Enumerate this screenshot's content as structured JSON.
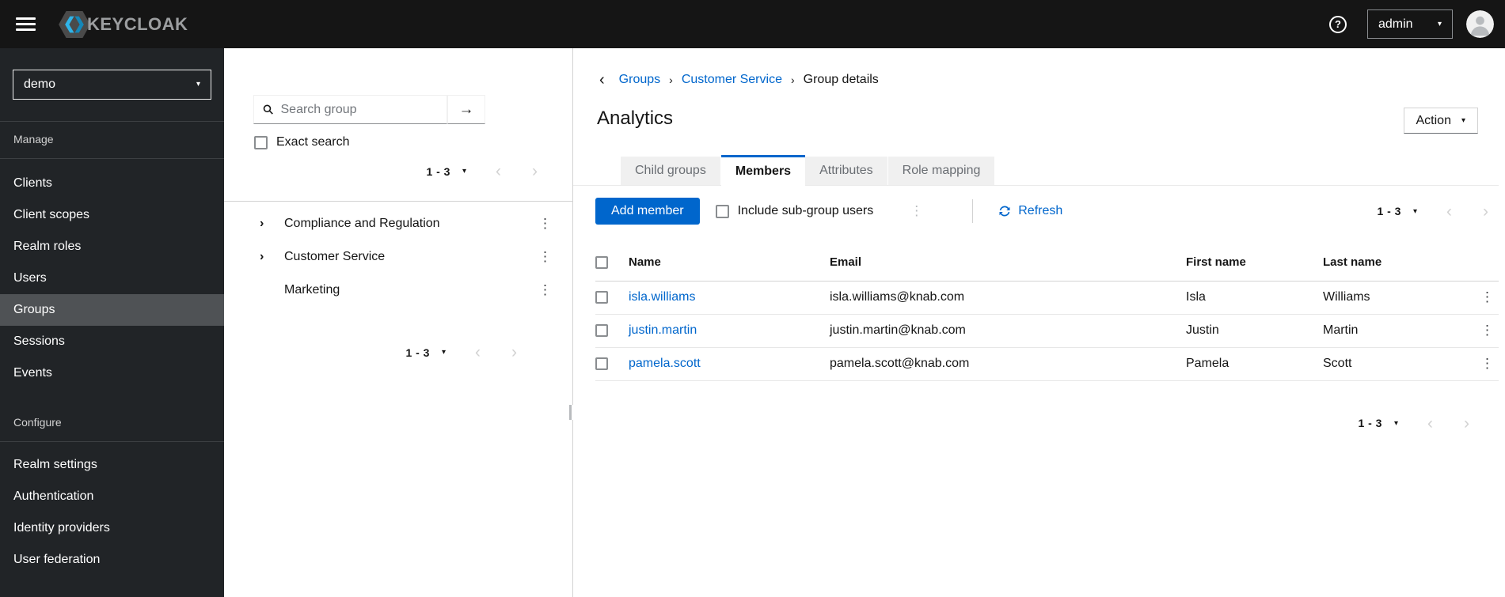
{
  "topbar": {
    "brand": "KEYCLOAK",
    "username": "admin"
  },
  "realm": {
    "name": "demo"
  },
  "sidebar": {
    "manage_label": "Manage",
    "manage_items": [
      "Clients",
      "Client scopes",
      "Realm roles",
      "Users",
      "Groups",
      "Sessions",
      "Events"
    ],
    "active_item": "Groups",
    "configure_label": "Configure",
    "configure_items": [
      "Realm settings",
      "Authentication",
      "Identity providers",
      "User federation"
    ]
  },
  "group_tree": {
    "search_placeholder": "Search group",
    "exact_search_label": "Exact search",
    "pagination_range": "1 - 3",
    "items": [
      {
        "label": "Compliance and Regulation",
        "expandable": true
      },
      {
        "label": "Customer Service",
        "expandable": true
      },
      {
        "label": "Marketing",
        "expandable": false
      }
    ]
  },
  "main": {
    "breadcrumb": {
      "groups": "Groups",
      "parent": "Customer Service",
      "current": "Group details"
    },
    "title": "Analytics",
    "action_button_label": "Action",
    "tabs": [
      {
        "label": "Child groups",
        "active": false
      },
      {
        "label": "Members",
        "active": true
      },
      {
        "label": "Attributes",
        "active": false
      },
      {
        "label": "Role mapping",
        "active": false
      }
    ],
    "toolbar": {
      "add_member_label": "Add member",
      "include_subgroups_label": "Include sub-group users",
      "refresh_label": "Refresh"
    },
    "pagination_range": "1 - 3",
    "table": {
      "headers": [
        "Name",
        "Email",
        "First name",
        "Last name"
      ],
      "rows": [
        {
          "name": "isla.williams",
          "email": "isla.williams@knab.com",
          "first": "Isla",
          "last": "Williams"
        },
        {
          "name": "justin.martin",
          "email": "justin.martin@knab.com",
          "first": "Justin",
          "last": "Martin"
        },
        {
          "name": "pamela.scott",
          "email": "pamela.scott@knab.com",
          "first": "Pamela",
          "last": "Scott"
        }
      ]
    }
  },
  "icons": {
    "help": "?",
    "caret_down": "▾",
    "chevron_left": "‹",
    "chevron_right": "›",
    "breadcrumb_back": "‹",
    "breadcrumb_sep": "›",
    "kebab": "⋮",
    "arrow_right": "→"
  },
  "colors": {
    "primary": "#0066cc",
    "sidebar_bg": "#212427",
    "topbar_bg": "#151515",
    "active_nav_bg": "#4f5255"
  }
}
